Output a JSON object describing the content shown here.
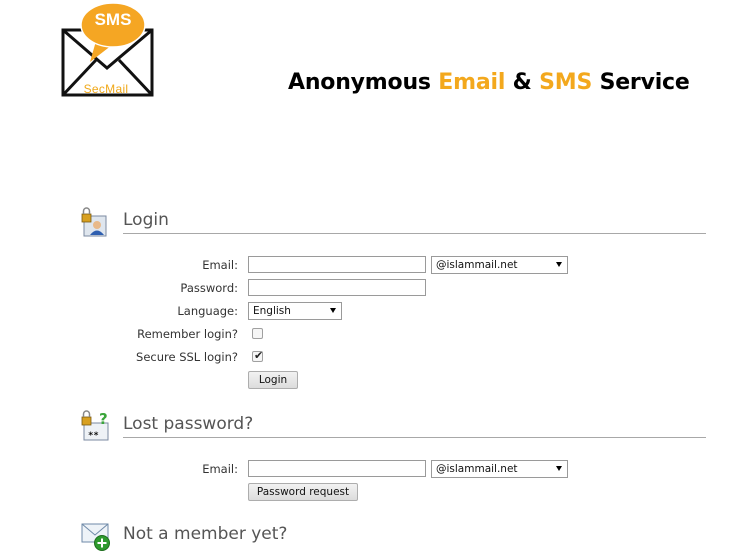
{
  "header": {
    "logo": {
      "badge_text": "SMS",
      "word_text": "SecMail",
      "icon": "envelope-speech-bubble-icon",
      "accent_color": "#f3a81d"
    },
    "headline": {
      "part1": "Anonymous",
      "part2": "Email",
      "part3": "&",
      "part4": "SMS",
      "part5": "Service"
    }
  },
  "login": {
    "title": "Login",
    "icon": "lock-user-icon",
    "email_label": "Email:",
    "email_value": "",
    "domain_selected": "@islammail.net",
    "password_label": "Password:",
    "password_value": "",
    "language_label": "Language:",
    "language_selected": "English",
    "remember_label": "Remember login?",
    "remember_checked": false,
    "ssl_label": "Secure SSL login?",
    "ssl_checked": true,
    "submit_label": "Login"
  },
  "lost_password": {
    "title": "Lost password?",
    "icon": "lock-question-icon",
    "email_label": "Email:",
    "email_value": "",
    "domain_selected": "@islammail.net",
    "submit_label": "Password request"
  },
  "signup": {
    "title": "Not a member yet?",
    "icon": "envelope-add-icon"
  }
}
